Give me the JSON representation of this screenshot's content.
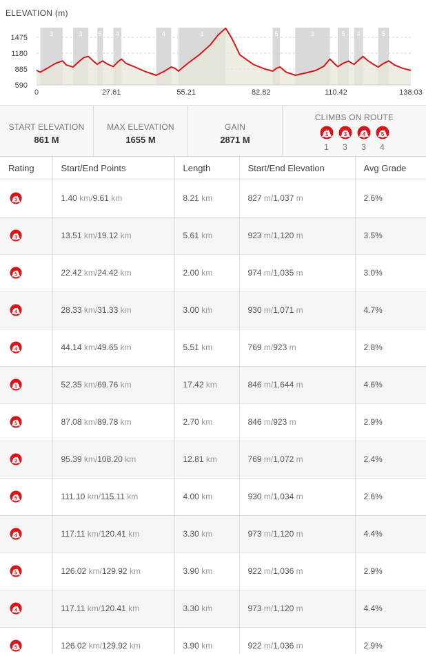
{
  "chart": {
    "title": "ELEVATION (m)",
    "line_color": "#d8151b",
    "fill_color": "#e9e6d8"
  },
  "chart_data": {
    "type": "area",
    "ylim": [
      590,
      1655
    ],
    "xlim": [
      0,
      138.03
    ],
    "x_ticks": [
      "0",
      "27.61",
      "55.21",
      "82.82",
      "110.42",
      "138.03"
    ],
    "x_tick_values": [
      0,
      27.61,
      55.21,
      82.82,
      110.42,
      138.03
    ],
    "y_ticks": [
      "1475",
      "1180",
      "885",
      "590"
    ],
    "y_tick_values": [
      1475,
      1180,
      885,
      590
    ],
    "grid": true,
    "x": [
      0,
      1.4,
      4,
      7,
      9.61,
      11,
      13.51,
      16,
      17.5,
      19.12,
      21,
      22.42,
      23.5,
      24.42,
      26,
      28.33,
      30,
      31.33,
      33,
      36,
      40,
      44.14,
      47,
      49.65,
      51,
      52.35,
      56,
      60,
      64,
      67,
      69.76,
      72,
      75,
      80,
      84,
      87.08,
      88.5,
      89.78,
      92,
      95.39,
      99,
      103,
      106,
      108.2,
      110,
      111.1,
      113,
      115.11,
      116,
      117.11,
      119,
      120.41,
      122,
      124,
      126.02,
      128,
      129.92,
      132,
      135,
      138.03
    ],
    "y": [
      861,
      827,
      900,
      990,
      1037,
      960,
      923,
      1040,
      1100,
      1120,
      1030,
      974,
      1010,
      1035,
      980,
      930,
      1020,
      1071,
      990,
      930,
      840,
      769,
      840,
      923,
      900,
      846,
      1000,
      1150,
      1330,
      1520,
      1644,
      1460,
      1150,
      970,
      890,
      846,
      900,
      923,
      830,
      769,
      810,
      860,
      940,
      1072,
      980,
      930,
      990,
      1034,
      1000,
      973,
      1060,
      1120,
      1050,
      980,
      922,
      990,
      1036,
      960,
      900,
      860
    ],
    "climb_bands": [
      {
        "label": "3",
        "start": 1.4,
        "end": 9.61
      },
      {
        "label": "3",
        "start": 13.51,
        "end": 19.12
      },
      {
        "label": "5",
        "start": 22.42,
        "end": 24.42
      },
      {
        "label": "4",
        "start": 28.33,
        "end": 31.33
      },
      {
        "label": "4",
        "start": 44.14,
        "end": 49.65
      },
      {
        "label": "1",
        "start": 52.35,
        "end": 69.76
      },
      {
        "label": "5",
        "start": 87.08,
        "end": 89.78
      },
      {
        "label": "3",
        "start": 95.39,
        "end": 108.2
      },
      {
        "label": "5",
        "start": 111.1,
        "end": 115.11
      },
      {
        "label": "4",
        "start": 117.11,
        "end": 120.41
      },
      {
        "label": "5",
        "start": 126.02,
        "end": 129.92
      }
    ]
  },
  "stats": {
    "start_elevation_label": "START ELEVATION",
    "start_elevation_value": "861 M",
    "max_elevation_label": "MAX ELEVATION",
    "max_elevation_value": "1655 M",
    "gain_label": "GAIN",
    "gain_value": "2871 M",
    "climbs_label": "CLIMBS ON ROUTE",
    "climbs": [
      {
        "category": "1",
        "count": "1"
      },
      {
        "category": "3",
        "count": "3"
      },
      {
        "category": "4",
        "count": "3"
      },
      {
        "category": "5",
        "count": "4"
      }
    ]
  },
  "table": {
    "headers": {
      "rating": "Rating",
      "points": "Start/End Points",
      "length": "Length",
      "elevation": "Start/End Elevation",
      "grade": "Avg Grade"
    },
    "units": {
      "km": "km",
      "m": "m",
      "sep": "/"
    },
    "rows": [
      {
        "rating": "3",
        "start_km": "1.40",
        "end_km": "9.61",
        "length": "8.21",
        "start_elev": "827",
        "end_elev": "1,037",
        "grade": "2.6%"
      },
      {
        "rating": "3",
        "start_km": "13.51",
        "end_km": "19.12",
        "length": "5.61",
        "start_elev": "923",
        "end_elev": "1,120",
        "grade": "3.5%"
      },
      {
        "rating": "5",
        "start_km": "22.42",
        "end_km": "24.42",
        "length": "2.00",
        "start_elev": "974",
        "end_elev": "1,035",
        "grade": "3.0%"
      },
      {
        "rating": "4",
        "start_km": "28.33",
        "end_km": "31.33",
        "length": "3.00",
        "start_elev": "930",
        "end_elev": "1,071",
        "grade": "4.7%"
      },
      {
        "rating": "4",
        "start_km": "44.14",
        "end_km": "49.65",
        "length": "5.51",
        "start_elev": "769",
        "end_elev": "923",
        "grade": "2.8%"
      },
      {
        "rating": "1",
        "start_km": "52.35",
        "end_km": "69.76",
        "length": "17.42",
        "start_elev": "846",
        "end_elev": "1,644",
        "grade": "4.6%"
      },
      {
        "rating": "5",
        "start_km": "87.08",
        "end_km": "89.78",
        "length": "2.70",
        "start_elev": "846",
        "end_elev": "923",
        "grade": "2.9%"
      },
      {
        "rating": "3",
        "start_km": "95.39",
        "end_km": "108.20",
        "length": "12.81",
        "start_elev": "769",
        "end_elev": "1,072",
        "grade": "2.4%"
      },
      {
        "rating": "5",
        "start_km": "111.10",
        "end_km": "115.11",
        "length": "4.00",
        "start_elev": "930",
        "end_elev": "1,034",
        "grade": "2.6%"
      },
      {
        "rating": "4",
        "start_km": "117.11",
        "end_km": "120.41",
        "length": "3.30",
        "start_elev": "973",
        "end_elev": "1,120",
        "grade": "4.4%"
      },
      {
        "rating": "5",
        "start_km": "126.02",
        "end_km": "129.92",
        "length": "3.90",
        "start_elev": "922",
        "end_elev": "1,036",
        "grade": "2.9%"
      },
      {
        "rating": "4",
        "start_km": "117.11",
        "end_km": "120.41",
        "length": "3.30",
        "start_elev": "973",
        "end_elev": "1,120",
        "grade": "4.4%"
      },
      {
        "rating": "5",
        "start_km": "126.02",
        "end_km": "129.92",
        "length": "3.90",
        "start_elev": "922",
        "end_elev": "1,036",
        "grade": "2.9%"
      }
    ]
  },
  "colors": {
    "badge_red": "#d8151b",
    "badge_white": "#ffffff",
    "band": "#d9d9d9"
  },
  "icons": {
    "climb_badge": "climb-category-icon"
  }
}
